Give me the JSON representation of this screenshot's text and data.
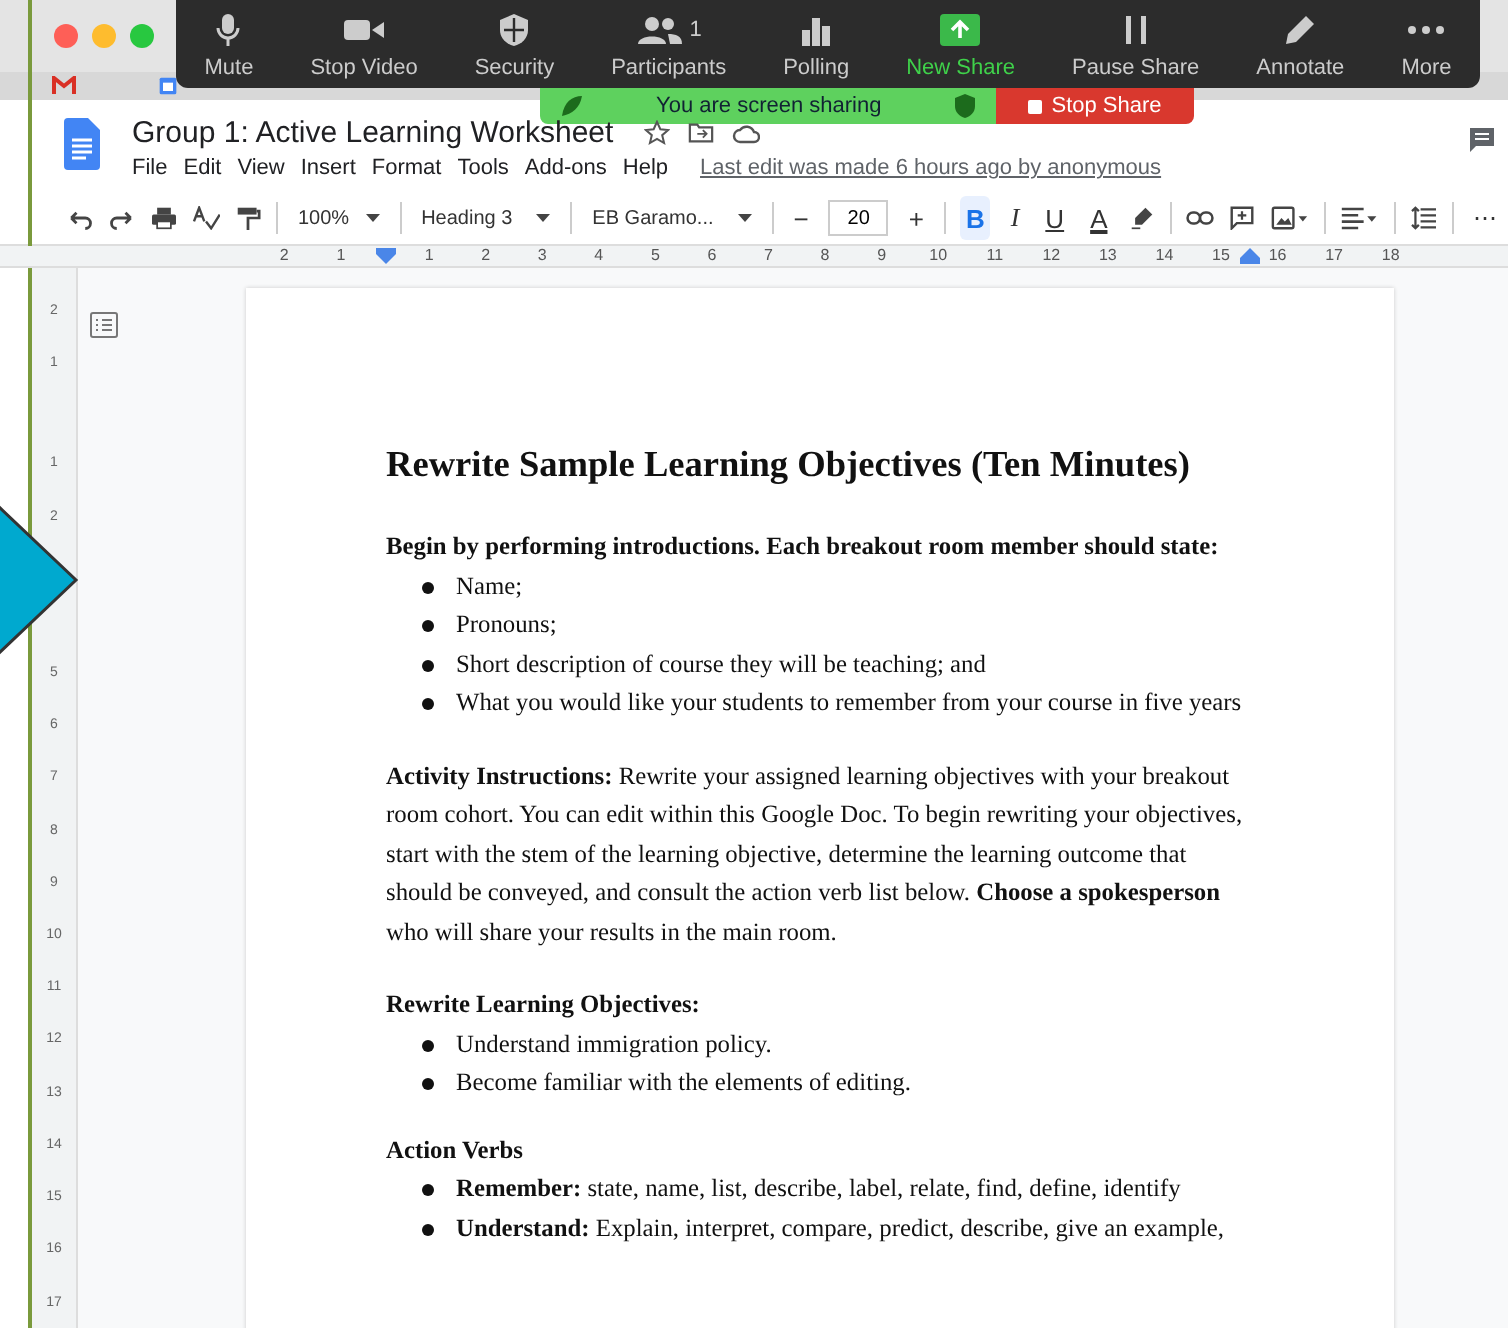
{
  "meeting_toolbar": {
    "buttons": [
      {
        "label": "Mute",
        "active": false
      },
      {
        "label": "Stop Video",
        "active": false
      },
      {
        "label": "Security",
        "active": false
      },
      {
        "label": "Participants",
        "count": "1",
        "active": false
      },
      {
        "label": "Polling",
        "active": false
      },
      {
        "label": "New Share",
        "active": true
      },
      {
        "label": "Pause Share",
        "active": false
      },
      {
        "label": "Annotate",
        "active": false
      },
      {
        "label": "More",
        "active": false
      }
    ]
  },
  "sharing_banner": {
    "text": "You are screen sharing",
    "stop_button": "Stop Share"
  },
  "document": {
    "title": "Group 1: Active Learning Worksheet",
    "menu": [
      "File",
      "Edit",
      "View",
      "Insert",
      "Format",
      "Tools",
      "Add-ons",
      "Help"
    ],
    "last_edit": "Last edit was made 6 hours ago by anonymous"
  },
  "toolbar": {
    "zoom": "100%",
    "style": "Heading 3",
    "font": "EB Garamo...",
    "size_minus": "−",
    "size": "20",
    "size_plus": "+",
    "format_buttons": [
      {
        "label": "B",
        "selected": true
      },
      {
        "label": "I",
        "selected": false
      },
      {
        "label": "U",
        "selected": false
      },
      {
        "label": "A",
        "selected": false
      }
    ],
    "more": "⋯"
  },
  "horizontal_ruler": [
    "2",
    "1",
    "1",
    "2",
    "3",
    "4",
    "5",
    "6",
    "7",
    "8",
    "9",
    "10",
    "11",
    "12",
    "13",
    "14",
    "15",
    "16",
    "17",
    "18"
  ],
  "vertical_ruler": {
    "upper": [
      "2",
      "1",
      "1",
      "2"
    ],
    "lower": [
      "5",
      "6",
      "7",
      "8",
      "9",
      "10",
      "11",
      "12",
      "13",
      "14",
      "15",
      "16",
      "17"
    ]
  },
  "page": {
    "heading": "Rewrite Sample Learning Objectives (Ten Minutes)",
    "intro": "Begin by performing introductions. Each breakout room member should state:",
    "intro_bullets": [
      "Name;",
      "Pronouns;",
      "Short description of course they will be teaching; and",
      "What you would like your students to remember from your course in five years"
    ],
    "instructions": "**Activity Instructions:** Rewrite your assigned learning objectives with your breakout room cohort. You can edit within this Google Doc. To begin rewriting your objectives, start with the stem of the learning objective, determine the learning outcome that should be conveyed, and consult the action verb list below. **Choose a spokesperson** who will share your results in the main room.",
    "objectives_heading": "Rewrite Learning Objectives:",
    "objectives": [
      "Understand immigration policy.",
      "Become familiar with the elements of editing."
    ],
    "verbs_heading": "Action Verbs",
    "verbs": [
      "**Remember:** state, name, list, describe, label, relate, find, define, identify",
      "**Understand:** Explain, interpret, compare, predict, describe, give an example,"
    ]
  }
}
